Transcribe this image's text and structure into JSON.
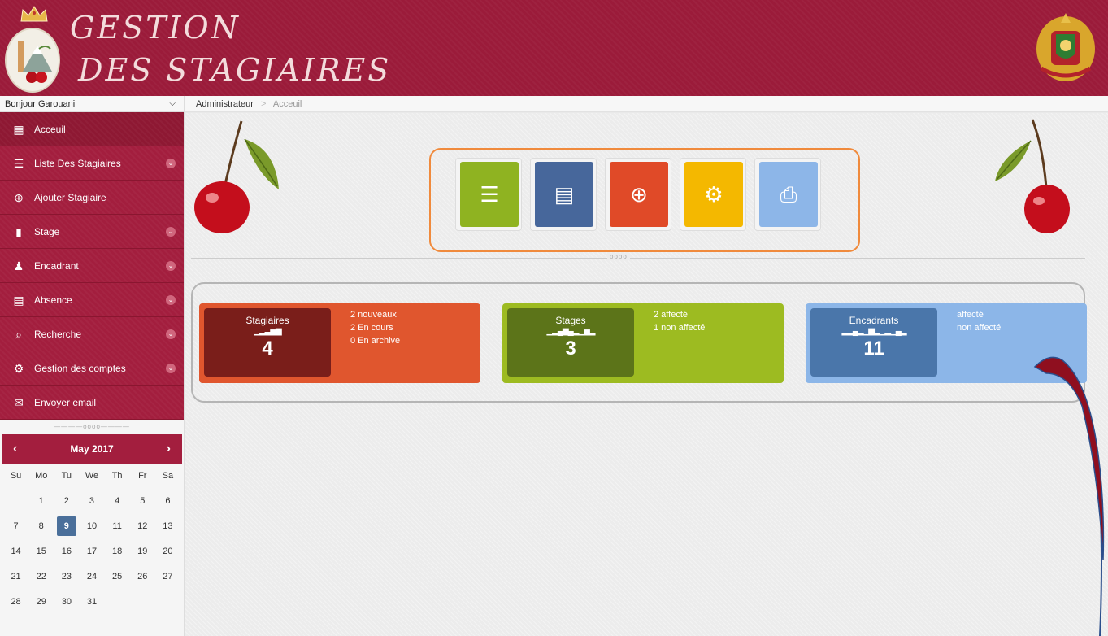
{
  "app": {
    "title_line1": "GESTION",
    "title_line2": "DES STAGIAIRES"
  },
  "user": {
    "greeting": "Bonjour Garouani"
  },
  "breadcrumb": {
    "root": "Administrateur",
    "current": "Acceuil"
  },
  "sidebar": {
    "items": [
      {
        "label": "Acceuil",
        "icon": "grid-icon"
      },
      {
        "label": "Liste Des Stagiaires",
        "icon": "list-icon"
      },
      {
        "label": "Ajouter Stagiaire",
        "icon": "plus-circle-icon"
      },
      {
        "label": "Stage",
        "icon": "file-icon"
      },
      {
        "label": "Encadrant",
        "icon": "users-icon"
      },
      {
        "label": "Absence",
        "icon": "document-icon"
      },
      {
        "label": "Recherche",
        "icon": "search-icon"
      },
      {
        "label": "Gestion des comptes",
        "icon": "gear-icon"
      },
      {
        "label": "Envoyer email",
        "icon": "envelope-icon"
      }
    ]
  },
  "calendar": {
    "month": "May 2017",
    "weekdays": [
      "Su",
      "Mo",
      "Tu",
      "We",
      "Th",
      "Fr",
      "Sa"
    ],
    "today": "9",
    "weeks": [
      [
        "",
        "1",
        "2",
        "3",
        "4",
        "5",
        "6"
      ],
      [
        "7",
        "8",
        "9",
        "10",
        "11",
        "12",
        "13"
      ],
      [
        "14",
        "15",
        "16",
        "17",
        "18",
        "19",
        "20"
      ],
      [
        "21",
        "22",
        "23",
        "24",
        "25",
        "26",
        "27"
      ],
      [
        "28",
        "29",
        "30",
        "31",
        "",
        "",
        ""
      ]
    ]
  },
  "quick_buttons": [
    {
      "icon": "list-icon",
      "color": "#8fb321"
    },
    {
      "icon": "archive-icon",
      "color": "#47679b"
    },
    {
      "icon": "target-icon",
      "color": "#e04a28"
    },
    {
      "icon": "gear-icon",
      "color": "#f4b800"
    },
    {
      "icon": "print-icon",
      "color": "#8db6e8"
    }
  ],
  "stats": [
    {
      "label": "Stagiaires",
      "value": "4",
      "lines": [
        "2 nouveaux",
        "2 En cours",
        "0 En archive"
      ],
      "color": "#e0562e",
      "inner_color": "#7a1e1a"
    },
    {
      "label": "Stages",
      "value": "3",
      "lines": [
        "2 affecté",
        "1 non affecté"
      ],
      "color": "#9dbb21",
      "inner_color": "#5c7419"
    },
    {
      "label": "Encadrants",
      "value": "11",
      "lines": [
        "affecté",
        "non affecté"
      ],
      "color": "#8cb6e8",
      "inner_color": "#4a76aa"
    }
  ]
}
